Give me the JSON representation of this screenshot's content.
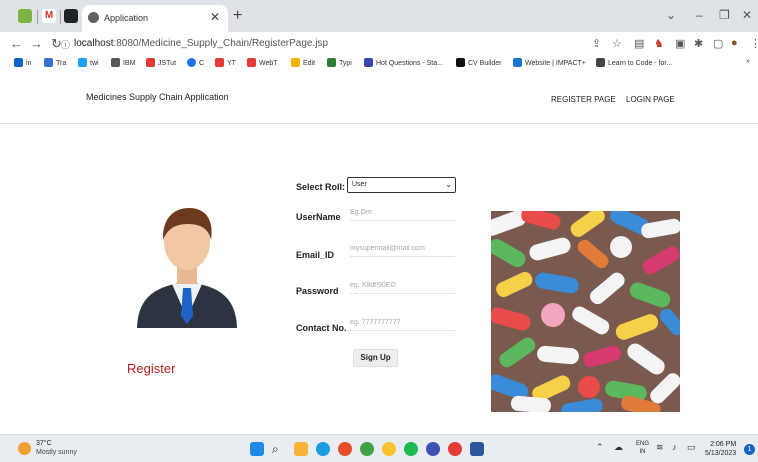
{
  "browser": {
    "tab_title": "Application",
    "url_host": "localhost",
    "url_path": ":8080/Medicine_Supply_Chain/RegisterPage.jsp",
    "bookmarks": [
      {
        "label": "in",
        "color": "#0a66c2"
      },
      {
        "label": "Tra",
        "color": "#3b6fd4"
      },
      {
        "label": "twi",
        "color": "#1da1f2"
      },
      {
        "label": "IBM",
        "color": "#555555"
      },
      {
        "label": "JSTut",
        "color": "#e53935"
      },
      {
        "label": "C",
        "color": "#1a73e8"
      },
      {
        "label": "YT",
        "color": "#e53935"
      },
      {
        "label": "WebT",
        "color": "#e53935"
      },
      {
        "label": "Edit",
        "color": "#f4b400"
      },
      {
        "label": "Typi",
        "color": "#2e7d32"
      },
      {
        "label": "Hot Questions - Sta...",
        "color": "#3949ab"
      },
      {
        "label": "CV Builder",
        "color": "#111111"
      },
      {
        "label": "Website | IMPACT+",
        "color": "#1976d2"
      },
      {
        "label": "Learn to Code - for...",
        "color": "#444444"
      }
    ]
  },
  "app": {
    "brand": "Medicines Supply Chain Application",
    "nav": {
      "register": "REGISTER PAGE",
      "login": "LOGIN PAGE"
    },
    "register_title": "Register",
    "form": {
      "role_label": "Select Roll:",
      "role_value": "User",
      "username_label": "UserName",
      "username_placeholder": "Eg.Om",
      "email_label": "Email_ID",
      "email_placeholder": "mysupermail@mail.com",
      "password_label": "Password",
      "password_placeholder": "eg. X8df!90EO",
      "contact_label": "Contact No.",
      "contact_placeholder": "eg. 7777777777",
      "submit_label": "Sign Up"
    }
  },
  "taskbar": {
    "temperature": "37°C",
    "weather": "Mostly sunny",
    "lang_top": "ENG",
    "lang_bottom": "IN",
    "time": "2:06 PM",
    "date": "5/13/2023",
    "notifications": "1"
  }
}
